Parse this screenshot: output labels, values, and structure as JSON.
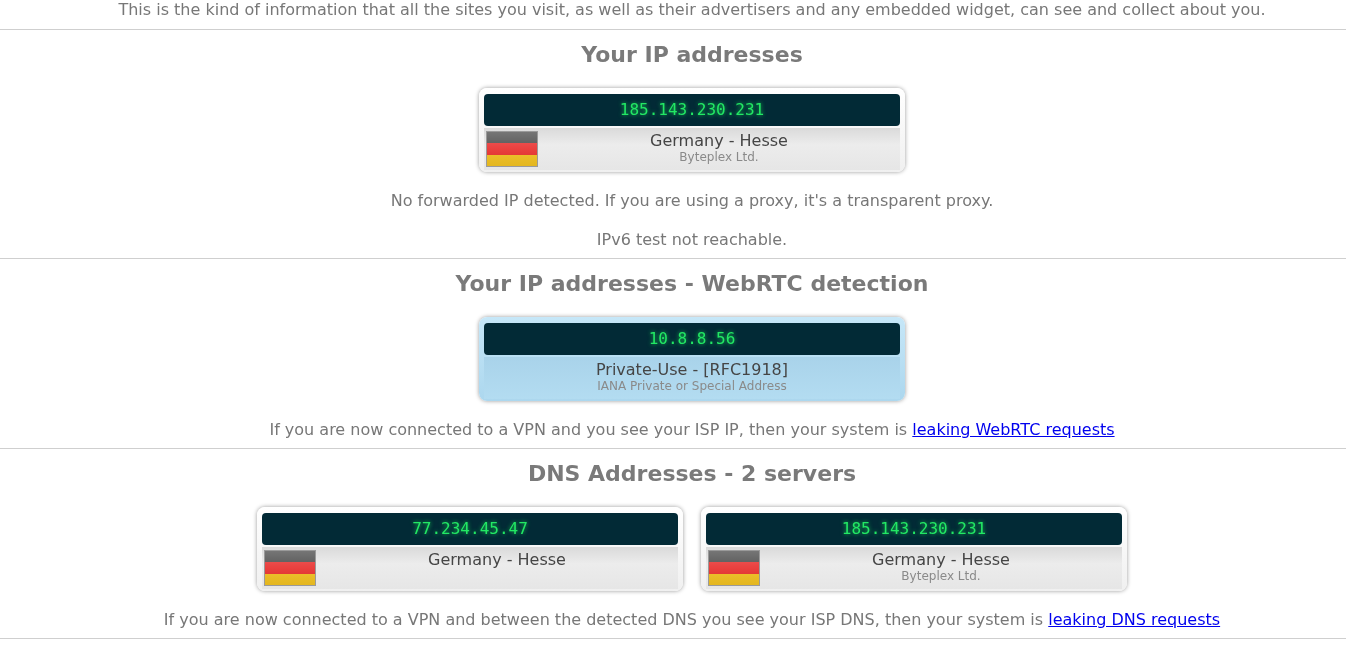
{
  "intro": "This is the kind of information that all the sites you visit, as well as their advertisers and any embedded widget, can see and collect about you.",
  "sections": [
    {
      "heading": "Your IP addresses",
      "cards": [
        {
          "kind": "geo",
          "ip": "185.143.230.231",
          "location": "Germany - Hesse",
          "provider": "Byteplex Ltd."
        }
      ],
      "notes": [
        {
          "text": "No forwarded IP detected. If you are using a proxy, it's a transparent proxy."
        },
        {
          "text": "IPv6 test not reachable."
        }
      ]
    },
    {
      "heading": "Your IP addresses - WebRTC detection",
      "cards": [
        {
          "kind": "private",
          "ip": "10.8.8.56",
          "location": "Private-Use - [RFC1918]",
          "provider": "IANA Private or Special Address"
        }
      ],
      "notes": [
        {
          "text": "If you are now connected to a VPN and you see your ISP IP, then your system is",
          "link": "leaking WebRTC requests"
        }
      ]
    },
    {
      "heading": "DNS Addresses - 2 servers",
      "cards": [
        {
          "kind": "geo",
          "ip": "77.234.45.47",
          "location": "Germany - Hesse"
        },
        {
          "kind": "geo",
          "ip": "185.143.230.231",
          "location": "Germany - Hesse",
          "provider": "Byteplex Ltd."
        }
      ],
      "notes": [
        {
          "text": "If you are now connected to a VPN and between the detected DNS you see your ISP DNS, then your system is",
          "link": "leaking DNS requests"
        }
      ]
    }
  ]
}
